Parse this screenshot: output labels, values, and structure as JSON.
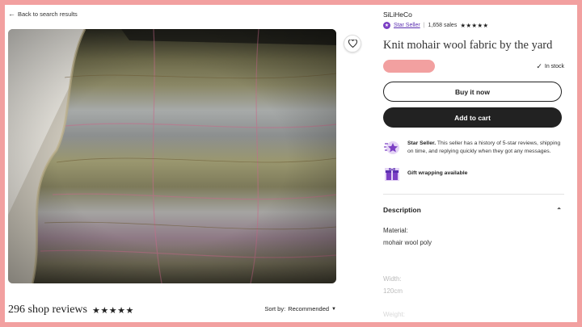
{
  "nav": {
    "back_label": "Back to search results"
  },
  "shop": {
    "name": "SiLiHeCo",
    "star_seller_label": "Star Seller",
    "sales": "1,658 sales",
    "rating_stars": "★★★★★"
  },
  "product": {
    "title": "Knit mohair wool fabric by the yard",
    "stock": "In stock"
  },
  "actions": {
    "buy_now": "Buy it now",
    "add_to_cart": "Add to cart"
  },
  "features": {
    "star_seller_title": "Star Seller.",
    "star_seller_text": "This seller has a history of 5-star reviews, shipping on time, and replying quickly when they got any messages.",
    "gift_wrap": "Gift wrapping available"
  },
  "description": {
    "heading": "Description",
    "specs": [
      {
        "label": "Material:",
        "value": "mohair wool poly"
      },
      {
        "label": "Width:",
        "value": "120cm"
      },
      {
        "label": "Weight:"
      }
    ]
  },
  "reviews": {
    "count_label": "296 shop reviews",
    "stars": "★★★★★",
    "sort_prefix": "Sort by:",
    "sort_value": "Recommended"
  },
  "colors": {
    "background_frame": "#f2a0a0",
    "star_seller_purple": "#7b3fc4",
    "button_dark": "#222222"
  }
}
